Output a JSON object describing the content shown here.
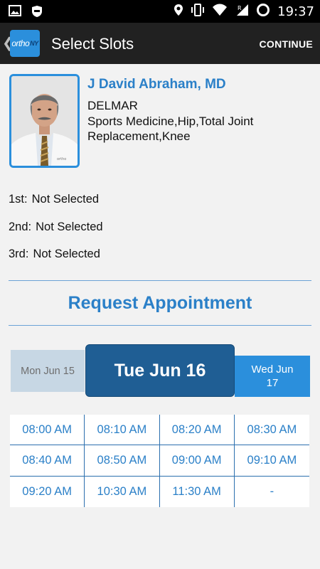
{
  "status_bar": {
    "time": "19:37",
    "icons": [
      "image-icon",
      "shield-icon",
      "location-icon",
      "vibrate-icon",
      "wifi-icon",
      "signal-roaming-icon",
      "loading-circle-icon"
    ]
  },
  "app_bar": {
    "logo_text": "ortho",
    "logo_suffix": "NY",
    "title": "Select Slots",
    "continue_label": "CONTINUE"
  },
  "doctor": {
    "name": "J David Abraham, MD",
    "location": "DELMAR",
    "specialty": "Sports Medicine,Hip,Total Joint Replacement,Knee"
  },
  "selections": [
    {
      "label": "1st:",
      "value": "Not Selected"
    },
    {
      "label": "2nd:",
      "value": "Not Selected"
    },
    {
      "label": "3rd:",
      "value": "Not Selected"
    }
  ],
  "request_title": "Request Appointment",
  "days": {
    "previous": "Mon Jun 15",
    "current": "Tue Jun 16",
    "next": "Wed Jun 17"
  },
  "time_slots": [
    "08:00 AM",
    "08:10 AM",
    "08:20 AM",
    "08:30 AM",
    "08:40 AM",
    "08:50 AM",
    "09:00 AM",
    "09:10 AM",
    "09:20 AM",
    "10:30 AM",
    "11:30 AM",
    "-"
  ],
  "colors": {
    "accent": "#2b80c8",
    "selected_day": "#1f5e94",
    "next_day": "#2b8fdc",
    "previous_day": "#c7d7e4",
    "app_bar": "#212121"
  }
}
